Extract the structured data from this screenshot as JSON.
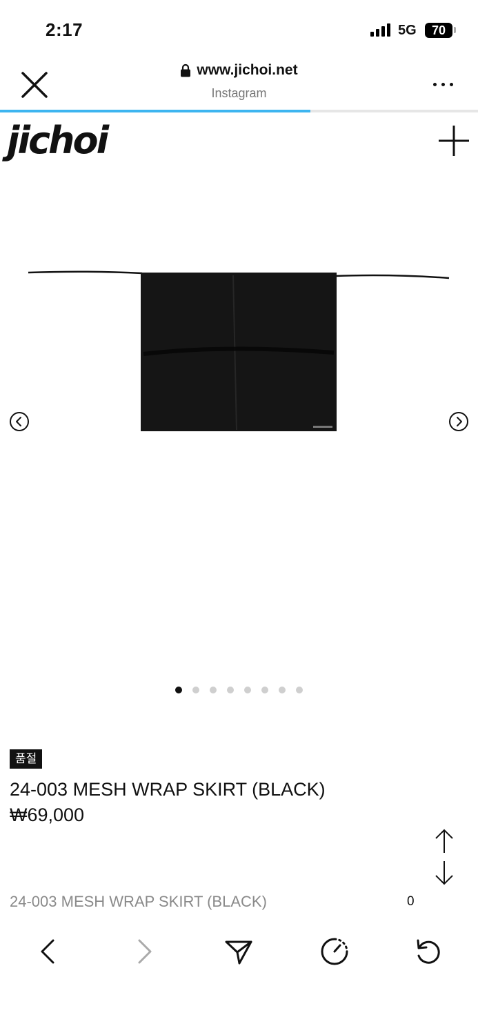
{
  "status_bar": {
    "time": "2:17",
    "network": "5G",
    "battery": "70"
  },
  "browser": {
    "url": "www.jichoi.net",
    "source": "Instagram",
    "load_progress_percent": 65,
    "accent_color": "#3db5f0",
    "icons": [
      "close-icon",
      "lock-icon",
      "more-icon"
    ]
  },
  "site": {
    "logo": "jichoi",
    "menu_icon": "plus-icon"
  },
  "gallery": {
    "image_count": 8,
    "active_index": 0,
    "prev_icon": "chevron-left-circle-icon",
    "next_icon": "chevron-right-circle-icon"
  },
  "product": {
    "badge": "품절",
    "name": "24-003 MESH WRAP SKIRT (BLACK)",
    "price": "₩69,000"
  },
  "footer": {
    "name": "24-003 MESH WRAP SKIRT (BLACK)",
    "quantity": "0",
    "scroll_icons": [
      "arrow-up-icon",
      "arrow-down-icon"
    ]
  },
  "toolbar": {
    "icons": [
      "back-icon",
      "forward-icon",
      "share-icon",
      "timer-icon",
      "reload-icon"
    ]
  }
}
